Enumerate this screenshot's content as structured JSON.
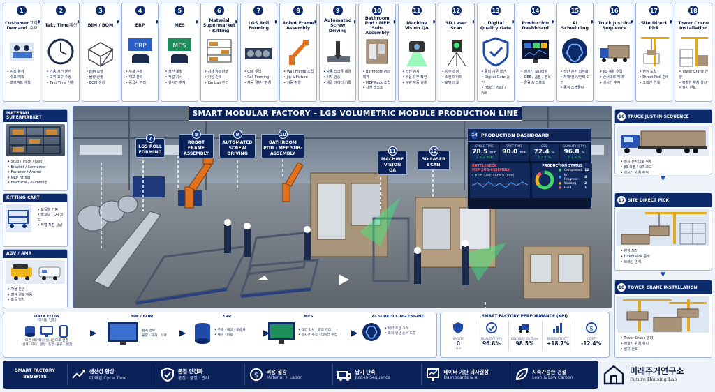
{
  "steps": [
    {
      "n": "1",
      "title": "Customer Demand",
      "sub": "고객 수요",
      "items": [
        "시장 분석",
        "수요 예측",
        "프로젝트 계획"
      ]
    },
    {
      "n": "2",
      "title": "Takt Time",
      "sub": "계산",
      "items": [
        "가용 시간 분석",
        "고객 요구 수량",
        "Takt Time 산출"
      ]
    },
    {
      "n": "3",
      "title": "BIM / BOM",
      "sub": "",
      "items": [
        "BIM 모델",
        "물량 산출",
        "BOM 생성"
      ]
    },
    {
      "n": "4",
      "title": "ERP",
      "sub": "",
      "items": [
        "자재 구매",
        "재고 관리",
        "공급사 관리"
      ]
    },
    {
      "n": "5",
      "title": "MES",
      "sub": "",
      "items": [
        "생산 계획",
        "작업 지시",
        "실시간 추적"
      ]
    },
    {
      "n": "6",
      "title": "Material Supermarket · Kitting",
      "sub": "",
      "items": [
        "자재 슈퍼마켓",
        "키팅 준비",
        "Kanban 관리"
      ]
    },
    {
      "n": "7",
      "title": "LGS Roll Forming",
      "sub": "",
      "items": [
        "Coil 투입",
        "Roll Forming",
        "자동 절단 / 펀칭"
      ]
    },
    {
      "n": "8",
      "title": "Robot Frame Assembly",
      "sub": "",
      "items": [
        "Wall Frame 조립",
        "Jig & Fixture",
        "자동 정렬"
      ]
    },
    {
      "n": "9",
      "title": "Automated Screw Driving",
      "sub": "",
      "items": [
        "자동 스크류 체결",
        "위치 검증",
        "체결 데이터 기록"
      ]
    },
    {
      "n": "10",
      "title": "Bathroom Pod · MEP Sub-Assembly",
      "sub": "",
      "items": [
        "Bathroom Pod 제작",
        "MEP Rack 조립",
        "사전 테스트"
      ]
    },
    {
      "n": "11",
      "title": "Machine Vision QA",
      "sub": "",
      "items": [
        "비전 검사",
        "부품 유무 확인",
        "불량 자동 검출"
      ]
    },
    {
      "n": "12",
      "title": "3D Laser Scan",
      "sub": "",
      "items": [
        "치수 측정",
        "스캔 데이터",
        "모델 비교"
      ]
    },
    {
      "n": "13",
      "title": "Digital Quality Gate",
      "sub": "",
      "items": [
        "품질 기준 확인",
        "Digital Gate 승인",
        "Hold / Pass / Fail"
      ]
    },
    {
      "n": "14",
      "title": "Production Dashboard",
      "sub": "",
      "items": [
        "실시간 모니터링",
        "OEE / 품질 / 병목",
        "알람 & 리포트"
      ]
    },
    {
      "n": "15",
      "title": "AI Scheduling",
      "sub": "",
      "items": [
        "생산 순서 최적화",
        "자재/설비/인력 고려",
        "동적 스케줄링"
      ]
    },
    {
      "n": "16",
      "title": "Truck Just-in-Sequence",
      "sub": "",
      "items": [
        "JIS 계획 수립",
        "순서대로 적재",
        "실시간 추적"
      ]
    },
    {
      "n": "17",
      "title": "Site Direct Pick",
      "sub": "",
      "items": [
        "현장 도착",
        "Direct Pick 준비",
        "크레인 연계"
      ]
    },
    {
      "n": "18",
      "title": "Tower Crane Installation",
      "sub": "",
      "items": [
        "Tower Crane 인양",
        "정확한 위치 설치",
        "설치 완료"
      ]
    }
  ],
  "left": {
    "supermarket": {
      "title": "MATERIAL SUPERMARKET",
      "items": [
        "Stud / Track / Joist",
        "Bracket / Connector",
        "Fastener / Anchor",
        "MEP Fitting",
        "Electrical / Plumbing"
      ]
    },
    "kitting": {
      "title": "KITTING CART",
      "items": [
        "모듈별 키팅",
        "바코드 / QR 코드",
        "작업 지점 공급"
      ]
    },
    "agv": {
      "title": "AGV / AMR",
      "items": [
        "자율 운반",
        "최적 경로 이동",
        "충돌 방지"
      ]
    }
  },
  "hero": {
    "banner": "SMART MODULAR FACTORY – LGS VOLUMETRIC MODULE PRODUCTION LINE",
    "labels": [
      {
        "n": "7",
        "text": "LGS ROLL FORMING"
      },
      {
        "n": "8",
        "text": "ROBOT FRAME ASSEMBLY"
      },
      {
        "n": "9",
        "text": "AUTOMATED SCREW DRIVING"
      },
      {
        "n": "10",
        "text": "BATHROOM POD · MEP SUB-ASSEMBLY"
      },
      {
        "n": "11",
        "text": "MACHINE VISION QA"
      },
      {
        "n": "12",
        "text": "3D LASER SCAN"
      }
    ]
  },
  "dashboard": {
    "n": "14",
    "title": "PRODUCTION DASHBOARD",
    "kpis": [
      {
        "label": "CYCLE TIME",
        "value": "78.5",
        "unit": "min",
        "delta": "↓ 5.2 min"
      },
      {
        "label": "TAKT TIME",
        "value": "90.0",
        "unit": "min",
        "delta": ""
      },
      {
        "label": "OEE",
        "value": "72.4",
        "unit": "%",
        "delta": "↑ 3.1 %"
      },
      {
        "label": "QUALITY (FPY)",
        "value": "96.8",
        "unit": "%",
        "delta": "↑ 1.6 %"
      }
    ],
    "bottleneck_label": "BOTTLENECK",
    "bottleneck": "MEP SUB-ASSEMBLY",
    "trend_label": "CYCLE TIME TREND (min)",
    "status_title": "PRODUCTION STATUS",
    "status": [
      {
        "label": "Completed",
        "value": "12"
      },
      {
        "label": "In Progress",
        "value": "4"
      },
      {
        "label": "Waiting",
        "value": "2"
      },
      {
        "label": "Hold",
        "value": "1"
      }
    ]
  },
  "right": {
    "truck": {
      "n": "16",
      "title": "TRUCK JUST-IN-SEQUENCE",
      "items": [
        "설치 순서대로 적재",
        "JIS 라벨 / QR 코드",
        "실시간 위치 추적"
      ]
    },
    "site": {
      "n": "17",
      "title": "SITE DIRECT PICK",
      "items": [
        "현장 도착",
        "Direct Pick 준비",
        "크레인 연계"
      ]
    },
    "crane": {
      "n": "18",
      "title": "TOWER CRANE INSTALLATION",
      "items": [
        "Tower Crane 인양",
        "정확한 위치 설치",
        "설치 완료"
      ]
    }
  },
  "flow": {
    "data_title": "DATA FLOW",
    "data_sub": "(디지털 연결)",
    "data_text": "모든 데이터가 실시간으로 연결",
    "data_text2": "(설계 · 자재 · 생산 · 품질 · 물류 · 현장)",
    "bim_title": "BIM / BOM",
    "bim_text": "설계 정보\n물량 · 자재 · 스펙",
    "erp_title": "ERP",
    "erp_text": "• 구매 · 재고 · 공급사\n• 재무 · 비용",
    "mes_title": "MES",
    "mes_text": "• 작업 지시 · 공정 관리\n• 실시간 추적 · 데이터 수집",
    "ai_title": "AI SCHEDULING ENGINE",
    "ai_text": "• 제약 조건 고려\n• 최적 생산 순서 도출"
  },
  "kpi": {
    "title": "SMART FACTORY PERFORMANCE (KPI)",
    "cards": [
      {
        "label": "SAFETY",
        "value": "0",
        "sub": "사고"
      },
      {
        "label": "QUALITY (FPY)",
        "value": "96.8%",
        "sub": ""
      },
      {
        "label": "DELIVERY On Time",
        "value": "98.5%",
        "sub": ""
      },
      {
        "label": "PRODUCTIVITY",
        "value": "+18.7%",
        "sub": ""
      },
      {
        "label": "COST",
        "value": "-12.4%",
        "sub": ""
      }
    ]
  },
  "benefits": {
    "header": "SMART FACTORY BENEFITS",
    "items": [
      {
        "t": "생산성 향상",
        "s": "더 빠른 Cycle Time"
      },
      {
        "t": "품질 안정화",
        "s": "품질 · 품질 · 관리"
      },
      {
        "t": "비용 절감",
        "s": "Material + Labor"
      },
      {
        "t": "납기 단축",
        "s": "Just-in-Sequence"
      },
      {
        "t": "데이터 기반 의사결정",
        "s": "Dashboards & AI"
      },
      {
        "t": "지속가능한 건설",
        "s": "Lean & Low Carbon"
      }
    ]
  },
  "logo": {
    "title": "미래주거연구소",
    "sub": "Future Housing Lab"
  },
  "colors": {
    "navy": "#0d2a6b",
    "accent": "#1f4aa8",
    "good": "#47d16c",
    "bad": "#ff5a5a"
  }
}
